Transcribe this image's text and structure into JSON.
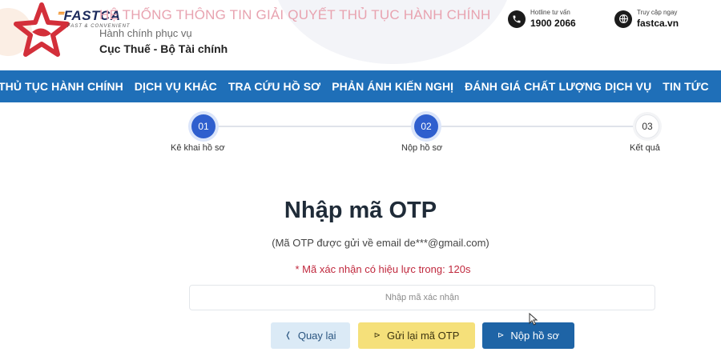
{
  "header": {
    "brand_name": "FASTCA",
    "brand_tagline": "FAST & CONVENIENT",
    "system_title": "HỆ THỐNG THÔNG TIN GIẢI QUYẾT THỦ TỤC HÀNH CHÍNH",
    "org_subtitle": "Hành chính phục vụ",
    "org_name": "Cục Thuế - Bộ Tài chính",
    "hotline_label": "Hotline tư vấn",
    "hotline_value": "1900 2066",
    "website_label": "Truy cập ngay",
    "website_value": "fastca.vn"
  },
  "nav": {
    "items": [
      {
        "label": "THỦ TỤC HÀNH CHÍNH"
      },
      {
        "label": "DỊCH VỤ KHÁC"
      },
      {
        "label": "TRA CỨU HỒ SƠ"
      },
      {
        "label": "PHẢN ÁNH KIẾN NGHỊ"
      },
      {
        "label": "ĐÁNH GIÁ CHẤT LƯỢNG DỊCH VỤ"
      },
      {
        "label": "TIN TỨC"
      }
    ]
  },
  "stepper": {
    "steps": [
      {
        "number": "01",
        "label": "Kê khai hồ sơ",
        "state": "active"
      },
      {
        "number": "02",
        "label": "Nộp hồ sơ",
        "state": "active"
      },
      {
        "number": "03",
        "label": "Kết quả",
        "state": "inactive"
      }
    ]
  },
  "otp": {
    "title": "Nhập mã OTP",
    "note": "(Mã OTP được gửi về email de***@gmail.com)",
    "validity": "* Mã xác nhận có hiệu lực trong: 120s",
    "input_placeholder": "Nhập mã xác nhận",
    "input_value": ""
  },
  "buttons": {
    "back_label": "Quay lại",
    "back_icon": "chevron-left-icon",
    "resend_label": "Gửi lại mã OTP",
    "resend_icon": "send-icon",
    "submit_label": "Nộp hồ sơ",
    "submit_icon": "send-icon"
  },
  "colors": {
    "nav_bg": "#1f6fb8",
    "step_active": "#2f5fce",
    "validity_text": "#c0283d",
    "back_button": "#dbeaf6",
    "resend_button": "#f5e07a",
    "submit_button": "#1e64a6"
  }
}
